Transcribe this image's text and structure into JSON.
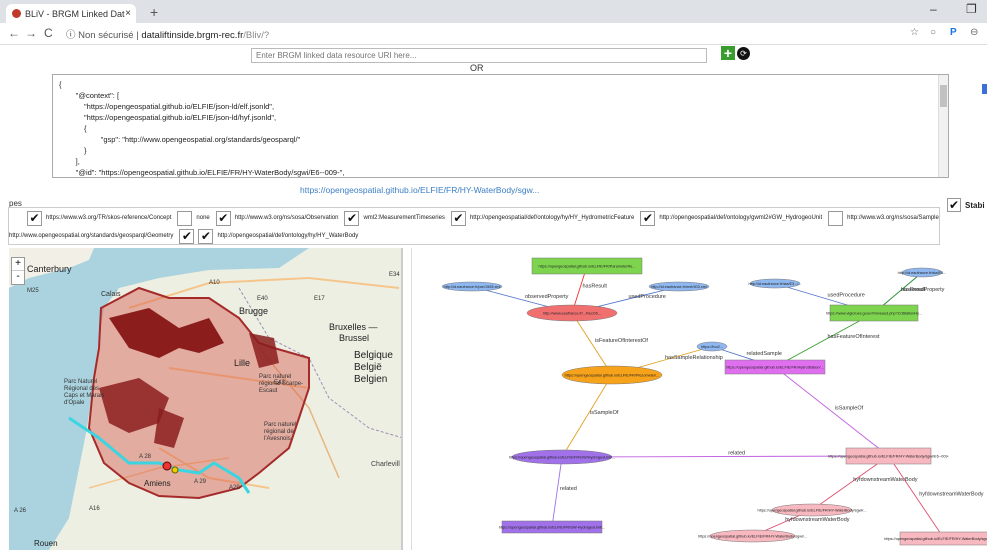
{
  "browser": {
    "tab_title": "BLiV - BRGM Linked Data Visuali",
    "tab_close": "×",
    "new_tab": "+",
    "security_label": "Non sécurisé",
    "url_host": "dataliftinside.brgm-rec.fr",
    "url_path": "/Bliv/?"
  },
  "search": {
    "placeholder": "Enter BRGM linked data resource URI here...",
    "or_label": "OR"
  },
  "json_input": {
    "text": "{\n        \"@context\": [\n            \"https://opengeospatial.github.io/ELFIE/json-ld/elf.jsonld\",\n            \"https://opengeospatial.github.io/ELFIE/json-ld/hyf.jsonld\",\n            {\n                    \"gsp\": \"http://www.opengeospatial.org/standards/geosparql/\"\n            }\n        ],\n        \"@id\": \"https://opengeospatial.github.io/ELFIE/FR/HY-WaterBody/sgwi/E6--009-\",\n        \"@type\": \"HY_WaterBody\","
  },
  "resource_link": "https://opengeospatial.github.io/ELFIE/FR/HY-WaterBody/sgw...",
  "filters": {
    "types_label": "pes",
    "row1": [
      {
        "label": "https://www.w3.org/TR/skos-reference/Concept",
        "checked": true
      },
      {
        "label": "none",
        "checked": false
      },
      {
        "label": "http://www.w3.org/ns/sosa/Observation",
        "checked": true
      },
      {
        "label": "wml2:MeasurementTimeseries",
        "checked": true
      },
      {
        "label": "http://opengeospatial/def/ontology/hy/HY_HydrometricFeature",
        "checked": true
      },
      {
        "label": "http://opengeospatial/def/ontology/gwml2#GW_HydrogeoUnit",
        "checked": true
      },
      {
        "label": "http://www.w3.org/ns/sosa/Sample",
        "checked": false
      }
    ],
    "row2": [
      {
        "label": "http://www.opengeospatial.org/standards/geosparql/Geometry",
        "checked": true
      },
      {
        "label": "http://opengeospatial/def/ontology/hy/HY_WaterBody",
        "checked": true
      }
    ],
    "stabilize_label": "Stabi"
  },
  "map": {
    "zoom_in": "+",
    "zoom_out": "-",
    "labels": {
      "canterbury": "Canterbury",
      "brugge": "Brugge",
      "bruxelles": "Bruxelles —\nBrussel",
      "belgique": "Belgique\nBelgië\nBelgien",
      "lille": "Lille",
      "amiens": "Amiens",
      "rouen": "Rouen",
      "charleville": "Charlevill\nMézières",
      "calais": "Calais",
      "pnr1": "Parc Naturel\nRégional des\nCaps et Marais\nd'Opale",
      "pnr2": "Parc naturel\nrégional Scarpe-\nEscaut",
      "pnr3": "Parc naturel\nrégional de\nl'Avesnois",
      "m25": "M25",
      "a10": "A10",
      "e40": "E40",
      "e17": "E17",
      "e34": "E34",
      "e42": "E42",
      "a29": "A29",
      "a28": "A 28",
      "a26": "A 26",
      "a16": "A16",
      "a29b": "A 29"
    }
  },
  "graph": {
    "nodes": [
      {
        "text": "https://opengeospatial.github.io/ELFIE/FR/ParameterRe...",
        "color": "#7ed44f",
        "kind": "rect"
      },
      {
        "text": "http://id.eaufrance.fr/par/1593.xml",
        "color": "#8fb8f0",
        "kind": "ellipse"
      },
      {
        "text": "http://www.eaufrance.fr/...RecOb...",
        "color": "#f07070",
        "kind": "ellipse"
      },
      {
        "text": "http://id.eaufrance.fr/met/403.xml",
        "color": "#8fb8f0",
        "kind": "ellipse"
      },
      {
        "text": "http://id.eaufrance.fr/sta/E3.../...",
        "color": "#8fb8f0",
        "kind": "ellipse"
      },
      {
        "text": "http://id.eaufrance.fr/sta/E5...",
        "color": "#8fb8f0",
        "kind": "ellipse"
      },
      {
        "text": "https://www.vigicrues.gouv.fr/niveau3.php?CdStationHy...",
        "color": "#7ed44f",
        "kind": "rect"
      },
      {
        "text": "https://opengeospatial.github.io/ELFIE/FR/Piezometer/...",
        "color": "#f7a21b",
        "kind": "ellipse"
      },
      {
        "text": "https://foo2...",
        "color": "#8fb8f0",
        "kind": "ellipse"
      },
      {
        "text": "https://opengeospatial.github.io/ELFIE/FR/HydroStation/...",
        "color": "#e06ff0",
        "kind": "rect"
      },
      {
        "text": "https://opengeospatial.github.io/ELFIE/FR/GW/HydrogeoUnit/...",
        "color": "#a071e8",
        "kind": "ellipse"
      },
      {
        "text": "https://opengeospatial.github.io/ELFIE/FR/HY-WaterBody/sgwi/E6--009-",
        "color": "#f8b8c0",
        "kind": "rect"
      },
      {
        "text": "https://opengeospatial.github.io/ELFIE/FR/GW-HydrogeoUnit/...",
        "color": "#a071e8",
        "kind": "rect"
      },
      {
        "text": "https://opengeospatial.github.io/ELFIE/FR/HY-WaterBody/sgwi/...",
        "color": "#f8b8c0",
        "kind": "ellipse"
      },
      {
        "text": "https://opengeospatial.github.io/ELFIE/FR/HY-WaterBody/sgwi/...",
        "color": "#f8b8c0",
        "kind": "ellipse"
      },
      {
        "text": "https://opengeospatial.github.io/ELFIE/FR/HY-WaterBody/sgwi/E6--015",
        "color": "#f8b8c0",
        "kind": "rect"
      }
    ],
    "edges": [
      {
        "label": "hasResult"
      },
      {
        "label": "observedProperty"
      },
      {
        "label": "usedProcedure"
      },
      {
        "label": "usedProcedure"
      },
      {
        "label": "observedProperty"
      },
      {
        "label": "hasResult"
      },
      {
        "label": "isFeatureOfInterestOf"
      },
      {
        "label": "hasSampleRelationship"
      },
      {
        "label": "relatedSample"
      },
      {
        "label": "hasFeatureOfInterest"
      },
      {
        "label": "isSampleOf"
      },
      {
        "label": "isSampleOf"
      },
      {
        "label": "related"
      },
      {
        "label": "related"
      },
      {
        "label": "hyfdownstreamWaterBody"
      },
      {
        "label": "hyfdownstreamWaterBody"
      },
      {
        "label": "hyfdownstreamWaterBody"
      }
    ]
  }
}
